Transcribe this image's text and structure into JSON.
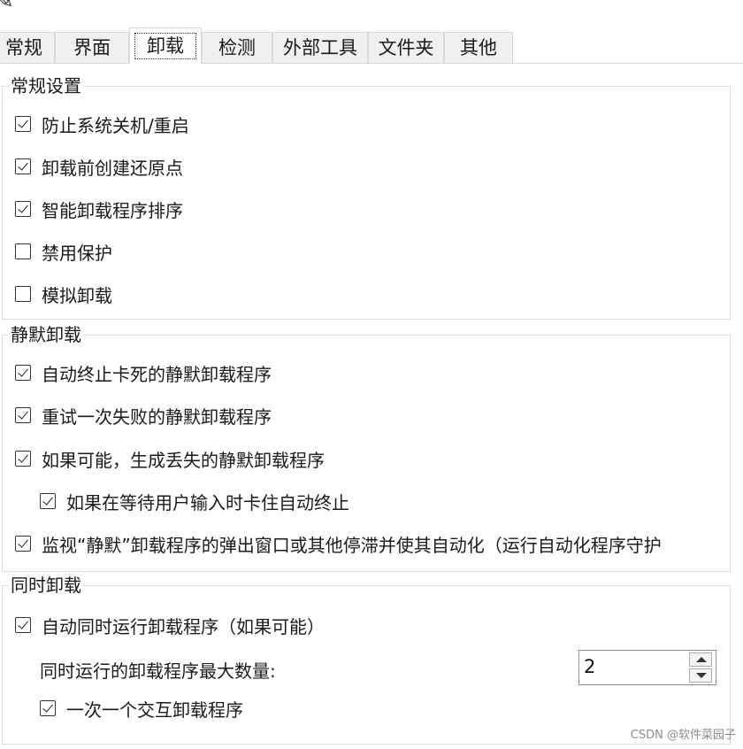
{
  "tabs": [
    {
      "label": "常规",
      "active": false
    },
    {
      "label": "界面",
      "active": false
    },
    {
      "label": "卸载",
      "active": true
    },
    {
      "label": "检测",
      "active": false
    },
    {
      "label": "外部工具",
      "active": false
    },
    {
      "label": "文件夹",
      "active": false
    },
    {
      "label": "其他",
      "active": false
    }
  ],
  "groups": {
    "general": {
      "title": "常规设置",
      "options": [
        {
          "label": "防止系统关机/重启",
          "checked": true
        },
        {
          "label": "卸载前创建还原点",
          "checked": true
        },
        {
          "label": "智能卸载程序排序",
          "checked": true
        },
        {
          "label": "禁用保护",
          "checked": false
        },
        {
          "label": "模拟卸载",
          "checked": false
        }
      ]
    },
    "silent": {
      "title": "静默卸载",
      "options": [
        {
          "label": "自动终止卡死的静默卸载程序",
          "checked": true
        },
        {
          "label": "重试一次失败的静默卸载程序",
          "checked": true
        },
        {
          "label": "如果可能，生成丢失的静默卸载程序",
          "checked": true
        },
        {
          "label": "如果在等待用户输入时卡住自动终止",
          "checked": true
        },
        {
          "label": "监视“静默”卸载程序的弹出窗口或其他停滞并使其自动化（运行自动化程序守护",
          "checked": true
        }
      ]
    },
    "concurrent": {
      "title": "同时卸载",
      "auto_run": {
        "label": "自动同时运行卸载程序（如果可能）",
        "checked": true
      },
      "max_count_label": "同时运行的卸载程序最大数量:",
      "max_count_value": "2",
      "one_interactive": {
        "label": "一次一个交互卸载程序",
        "checked": true
      }
    }
  },
  "watermark": "CSDN @软件菜园子"
}
